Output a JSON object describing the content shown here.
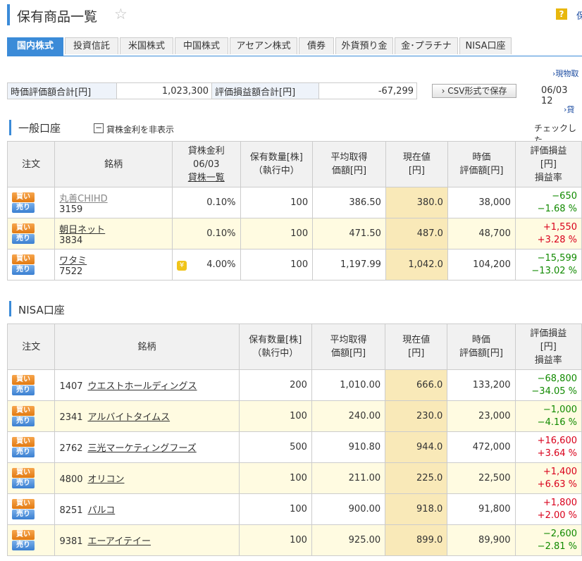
{
  "page": {
    "title": "保有商品一覧",
    "help_link": "保"
  },
  "tabs": [
    "国内株式",
    "投資信託",
    "米国株式",
    "中国株式",
    "アセアン株式",
    "債券",
    "外貨預り金",
    "金･プラチナ",
    "NISA口座"
  ],
  "links": {
    "genbutsu": "現物取",
    "kashi": "貸"
  },
  "summary": {
    "eval_label": "時価評価額合計[円]",
    "eval_value": "1,023,300",
    "pl_label": "評価損益額合計[円]",
    "pl_value": "-67,299",
    "csv_button": "CSV形式で保存",
    "date": "06/03 12"
  },
  "general": {
    "title": "一般口座",
    "hide_toggle": "−",
    "hide_label": "貸株金利を非表示",
    "check_text": "チェックした",
    "headers": {
      "order": "注文",
      "name": "銘柄",
      "lend1": "貸株金利",
      "lend2": "06/03",
      "lend3": "貸株一覧",
      "qty1": "保有数量[株]",
      "qty2": "（執行中）",
      "avg1": "平均取得",
      "avg2": "価額[円]",
      "cur1": "現在値",
      "cur2": "[円]",
      "eval1": "時価",
      "eval2": "評価額[円]",
      "pl1": "評価損益",
      "pl2": "[円]",
      "pl3": "損益率"
    },
    "rows": [
      {
        "name": "丸善CHIHD",
        "code": "3159",
        "lend": "0.10%",
        "qty": "100",
        "avg": "386.50",
        "cur": "380.0",
        "eval": "38,000",
        "pl": "−650",
        "rate": "−1.68 %",
        "sign": "neg",
        "icon": ""
      },
      {
        "name": "朝日ネット",
        "code": "3834",
        "lend": "0.10%",
        "qty": "100",
        "avg": "471.50",
        "cur": "487.0",
        "eval": "48,700",
        "pl": "+1,550",
        "rate": "+3.28 %",
        "sign": "pos",
        "icon": ""
      },
      {
        "name": "ワタミ",
        "code": "7522",
        "lend": "4.00%",
        "qty": "100",
        "avg": "1,197.99",
        "cur": "1,042.0",
        "eval": "104,200",
        "pl": "−15,599",
        "rate": "−13.02 %",
        "sign": "neg",
        "icon": "lend"
      }
    ]
  },
  "nisa": {
    "title": "NISA口座",
    "headers": {
      "order": "注文",
      "name": "銘柄",
      "qty1": "保有数量[株]",
      "qty2": "（執行中）",
      "avg1": "平均取得",
      "avg2": "価額[円]",
      "cur1": "現在値",
      "cur2": "[円]",
      "eval1": "時価",
      "eval2": "評価額[円]",
      "pl1": "評価損益",
      "pl2": "[円]",
      "pl3": "損益率"
    },
    "rows": [
      {
        "code": "1407",
        "name": "ウエストホールディングス",
        "qty": "200",
        "avg": "1,010.00",
        "cur": "666.0",
        "eval": "133,200",
        "pl": "−68,800",
        "rate": "−34.05 %",
        "sign": "neg"
      },
      {
        "code": "2341",
        "name": "アルバイトタイムス",
        "qty": "100",
        "avg": "240.00",
        "cur": "230.0",
        "eval": "23,000",
        "pl": "−1,000",
        "rate": "−4.16 %",
        "sign": "neg"
      },
      {
        "code": "2762",
        "name": "三光マーケティングフーズ",
        "qty": "500",
        "avg": "910.80",
        "cur": "944.0",
        "eval": "472,000",
        "pl": "+16,600",
        "rate": "+3.64 %",
        "sign": "pos"
      },
      {
        "code": "4800",
        "name": "オリコン",
        "qty": "100",
        "avg": "211.00",
        "cur": "225.0",
        "eval": "22,500",
        "pl": "+1,400",
        "rate": "+6.63 %",
        "sign": "pos"
      },
      {
        "code": "8251",
        "name": "パルコ",
        "qty": "100",
        "avg": "900.00",
        "cur": "918.0",
        "eval": "91,800",
        "pl": "+1,800",
        "rate": "+2.00 %",
        "sign": "pos"
      },
      {
        "code": "9381",
        "name": "エーアイテイー",
        "qty": "100",
        "avg": "925.00",
        "cur": "899.0",
        "eval": "89,900",
        "pl": "−2,600",
        "rate": "−2.81 %",
        "sign": "neg"
      }
    ]
  },
  "buttons": {
    "buy": "買い",
    "sell": "売り"
  },
  "colors": {
    "accent": "#3b8bd8",
    "current_bg": "#f9e9b8",
    "alt_row": "#fffbe1",
    "positive": "#d9001b",
    "negative": "#118a00"
  }
}
